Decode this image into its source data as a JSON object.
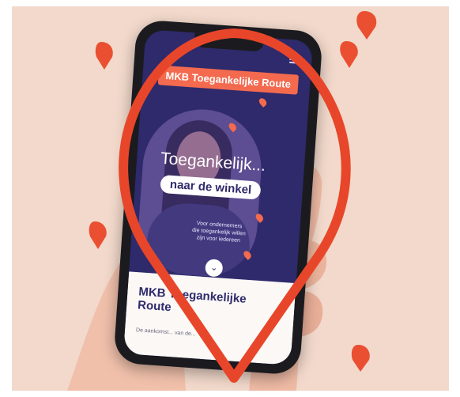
{
  "site": {
    "badge": "MKB Toegankelijke Route",
    "headline": "Toegankelijk...",
    "subheadline": "naar de winkel",
    "tagline": [
      "Voor ondernemers",
      "die toegankelijk willen",
      "zijn voor iedereen"
    ],
    "section_title": [
      "MKB Toegankelijke",
      "Route"
    ],
    "body_text": "De aankomst... van de..."
  },
  "icons": {
    "menu": "hamburger-menu-icon",
    "scroll": "chevron-down-icon",
    "pin": "map-pin-icon"
  },
  "colors": {
    "background": "#f2d9cb",
    "accent": "#f36a4f",
    "screen": "#2e2a6b",
    "panel": "#fbf8f6"
  }
}
